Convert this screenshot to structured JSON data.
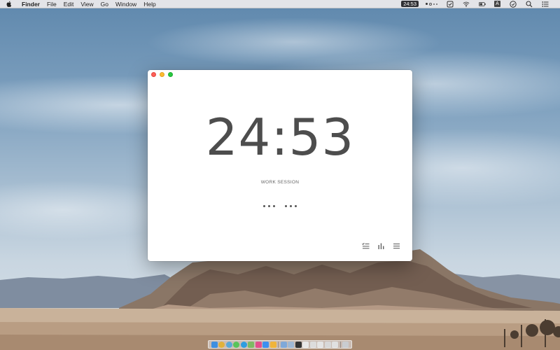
{
  "menubar": {
    "apple_icon": "apple-logo-icon",
    "app_name": "Finder",
    "menus": [
      "File",
      "Edit",
      "View",
      "Go",
      "Window",
      "Help"
    ],
    "clock_badge": "24:53",
    "input_source": "A",
    "status_icons": [
      "dots-status-icon",
      "checkbox-icon",
      "wifi-icon",
      "battery-icon",
      "input-source-icon",
      "clock-icon",
      "spotlight-search-icon",
      "notification-center-icon"
    ]
  },
  "window": {
    "timer": "24:53",
    "session_label": "WORK SESSION",
    "session_progress": {
      "groups": 2,
      "dots_per_group": 3
    },
    "toolbar": [
      "tasks-list-icon",
      "stats-chart-icon",
      "menu-icon"
    ]
  },
  "colors": {
    "close": "#fd5f57",
    "minimize": "#febc2e",
    "maximize": "#28c840",
    "timer_text": "#4d4d4d"
  },
  "dock": {
    "icons": [
      {
        "name": "finder",
        "color": "#3f8fe0"
      },
      {
        "name": "chrome",
        "color": "#e0b23a"
      },
      {
        "name": "safari",
        "color": "#5aa9d6"
      },
      {
        "name": "messages",
        "color": "#59c45a"
      },
      {
        "name": "skype",
        "color": "#2d9de0"
      },
      {
        "name": "maps",
        "color": "#7dbb63"
      },
      {
        "name": "itunes",
        "color": "#e2508c"
      },
      {
        "name": "app-store",
        "color": "#3d8ff0"
      },
      {
        "name": "trophy",
        "color": "#f0b43a"
      },
      {
        "name": "folder-1",
        "color": "#7fa8d8"
      },
      {
        "name": "folder-2",
        "color": "#9fb8d4"
      },
      {
        "name": "terminal",
        "color": "#333333"
      },
      {
        "name": "window-1",
        "color": "#e8e8e8"
      },
      {
        "name": "window-2",
        "color": "#dcdcdc"
      },
      {
        "name": "window-3",
        "color": "#e4e4e4"
      },
      {
        "name": "window-4",
        "color": "#d8d8d8"
      },
      {
        "name": "window-5",
        "color": "#e0e0e0"
      },
      {
        "name": "trash",
        "color": "#c9ccd0"
      }
    ]
  }
}
